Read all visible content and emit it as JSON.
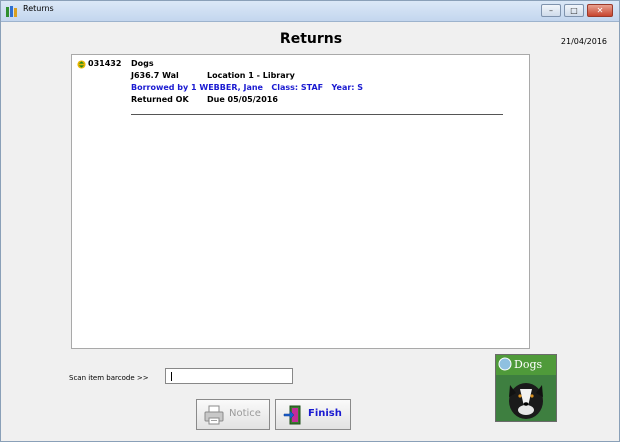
{
  "window": {
    "title": "Returns",
    "controls": {
      "minimize": "–",
      "maximize": "□",
      "close": "✕"
    }
  },
  "header": {
    "title": "Returns",
    "date": "21/04/2016"
  },
  "item": {
    "barcode": "031432",
    "title": "Dogs",
    "call_number": "J636.7 Wal",
    "location": "Location 1 - Library",
    "borrowed_by": "Borrowed by 1 WEBBER, Jane",
    "class": "Class: STAF",
    "year": "Year: S",
    "status": "Returned OK",
    "due": "Due 05/05/2016"
  },
  "scan": {
    "label": "Scan item barcode >>",
    "value": "",
    "placeholder": ""
  },
  "cover": {
    "title": "Dogs"
  },
  "buttons": {
    "notice": "Notice",
    "finish": "Finish"
  },
  "icons": {
    "app": "books-icon",
    "item_status": "arrows-icon",
    "notice": "printer-icon",
    "finish": "exit-door-icon"
  },
  "colors": {
    "borrower_text": "#1a1ad1",
    "finish_text": "#1a1ad1"
  }
}
